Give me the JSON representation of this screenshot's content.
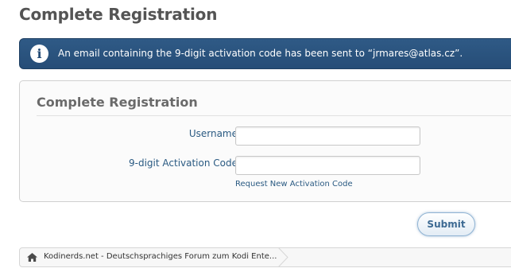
{
  "page": {
    "title": "Complete Registration"
  },
  "notice": {
    "icon": "info-icon",
    "text": "An email containing the 9-digit activation code has been sent to “jrmares@atlas.cz”."
  },
  "form": {
    "title": "Complete Registration",
    "username_label": "Username",
    "username_value": "",
    "code_label": "9-digit Activation Code",
    "code_value": "",
    "resend_link": "Request New Activation Code",
    "submit_label": "Submit"
  },
  "breadcrumb": {
    "icon": "home-icon",
    "item": "Kodinerds.net - Deutschsprachiges Forum zum Kodi Ente..."
  },
  "colors": {
    "notice_bg": "#264d77",
    "label": "#2a5a82",
    "title": "#545454"
  }
}
